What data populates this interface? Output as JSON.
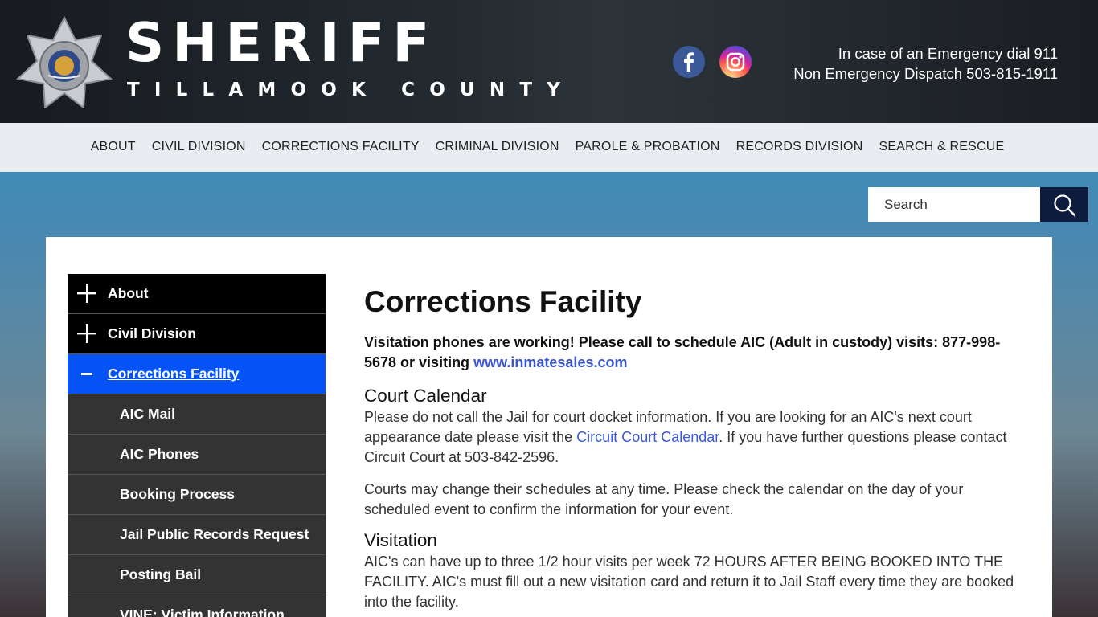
{
  "header": {
    "title": "SHERIFF",
    "subtitle": "TILLAMOOK COUNTY",
    "badge_text": "TILLAMOOK COUNTY",
    "emergency_line": "In case of an Emergency dial 911",
    "dispatch_line": "Non Emergency Dispatch 503-815-1911",
    "social": [
      "facebook-icon",
      "instagram-icon"
    ]
  },
  "nav": {
    "items": [
      {
        "label": "ABOUT"
      },
      {
        "label": "CIVIL DIVISION"
      },
      {
        "label": "CORRECTIONS FACILITY"
      },
      {
        "label": "CRIMINAL DIVISION"
      },
      {
        "label": "PAROLE & PROBATION"
      },
      {
        "label": "RECORDS DIVISION"
      },
      {
        "label": "SEARCH & RESCUE"
      }
    ]
  },
  "search": {
    "placeholder": "Search"
  },
  "sidebar": {
    "items": [
      {
        "label": "About",
        "icon": "plus-icon"
      },
      {
        "label": "Civil Division",
        "icon": "plus-icon"
      },
      {
        "label": "Corrections Facility",
        "icon": "minus-icon"
      },
      {
        "label": "AIC Mail"
      },
      {
        "label": "AIC Phones"
      },
      {
        "label": "Booking Process"
      },
      {
        "label": "Jail Public Records Request"
      },
      {
        "label": "Posting Bail"
      },
      {
        "label": "VINE: Victim Information"
      }
    ]
  },
  "main": {
    "title": "Corrections Facility",
    "notice": "Visitation phones are working! Please call to schedule AIC (Adult in custody) visits: 877-998-5678 or visiting ",
    "notice_link": "www.inmatesales.com",
    "court_heading": "Court Calendar",
    "court_p1_a": "Please do not call the Jail for court docket information.  If you are looking for an AIC's next court appearance date please visit the ",
    "court_p1_link": "Circuit Court Calendar",
    "court_p1_b": ".  If you have further questions please contact Circuit Court at 503-842-2596.",
    "court_p2": "Courts may change their schedules at any time. Please check the calendar on the day of your scheduled event to confirm the information for your event.",
    "visit_heading": "Visitation",
    "visit_p1": "AIC's can have up to three 1/2 hour visits per week 72 HOURS AFTER BEING BOOKED INTO THE FACILITY.  AIC's must fill out a new visitation card and return it to Jail Staff every time they are booked into the facility."
  },
  "colors": {
    "header_bg": "#1d2126",
    "nav_bg": "#e9edf1",
    "active_menu": "#0553f5",
    "submenu_bg": "#333333",
    "search_button": "#0d1b3d",
    "link": "#3a54d0"
  }
}
